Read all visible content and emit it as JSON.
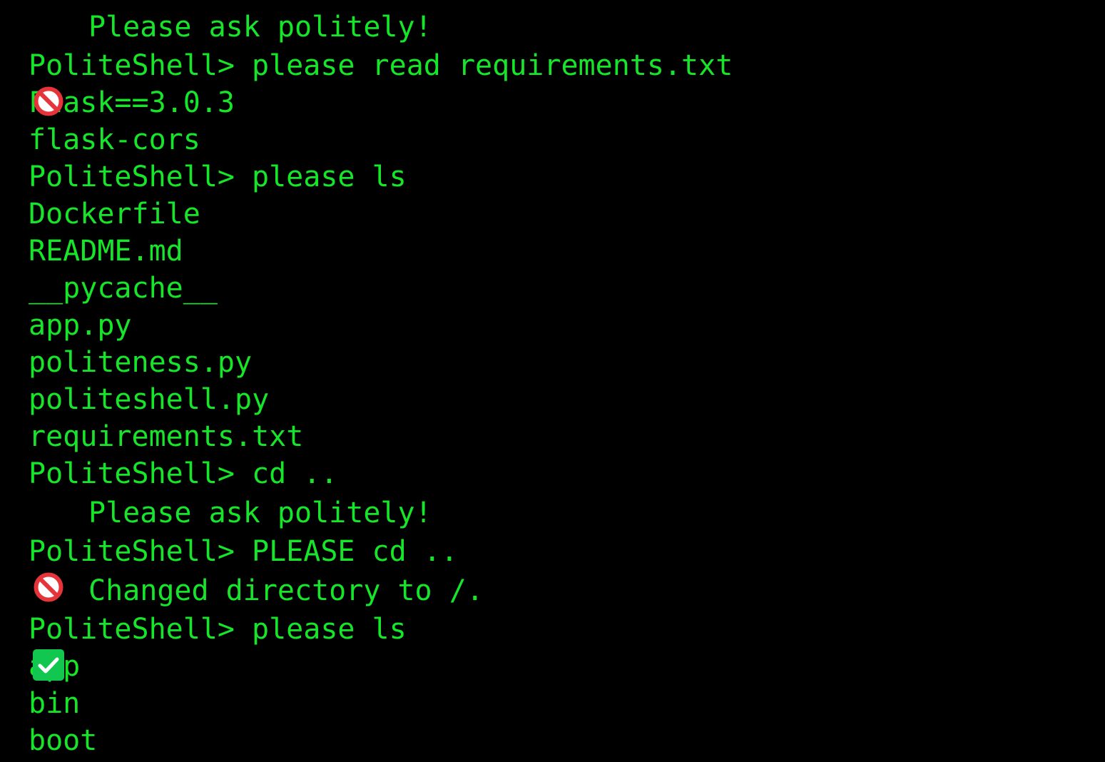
{
  "colors": {
    "background": "#000000",
    "text": "#16e62a",
    "prohibited_icon": "#e5343a",
    "check_icon": "#12c750"
  },
  "terminal": {
    "prompt": "PoliteShell>",
    "lines": [
      {
        "type": "message",
        "icon": "prohibited-icon",
        "text": "Please ask politely!"
      },
      {
        "type": "command",
        "command": "please read requirements.txt"
      },
      {
        "type": "output",
        "text": "Flask==3.0.3"
      },
      {
        "type": "output",
        "text": "flask-cors"
      },
      {
        "type": "command",
        "command": "please ls"
      },
      {
        "type": "output",
        "text": "Dockerfile"
      },
      {
        "type": "output",
        "text": "README.md"
      },
      {
        "type": "output",
        "text": "__pycache__"
      },
      {
        "type": "output",
        "text": "app.py"
      },
      {
        "type": "output",
        "text": "politeness.py"
      },
      {
        "type": "output",
        "text": "politeshell.py"
      },
      {
        "type": "output",
        "text": "requirements.txt"
      },
      {
        "type": "command",
        "command": "cd .."
      },
      {
        "type": "message",
        "icon": "prohibited-icon",
        "text": "Please ask politely!"
      },
      {
        "type": "command",
        "command": "PLEASE cd .."
      },
      {
        "type": "message",
        "icon": "check-mark-icon",
        "text": "Changed directory to /."
      },
      {
        "type": "command",
        "command": "please ls"
      },
      {
        "type": "output",
        "text": "app"
      },
      {
        "type": "output",
        "text": "bin"
      },
      {
        "type": "output",
        "text": "boot"
      }
    ]
  }
}
